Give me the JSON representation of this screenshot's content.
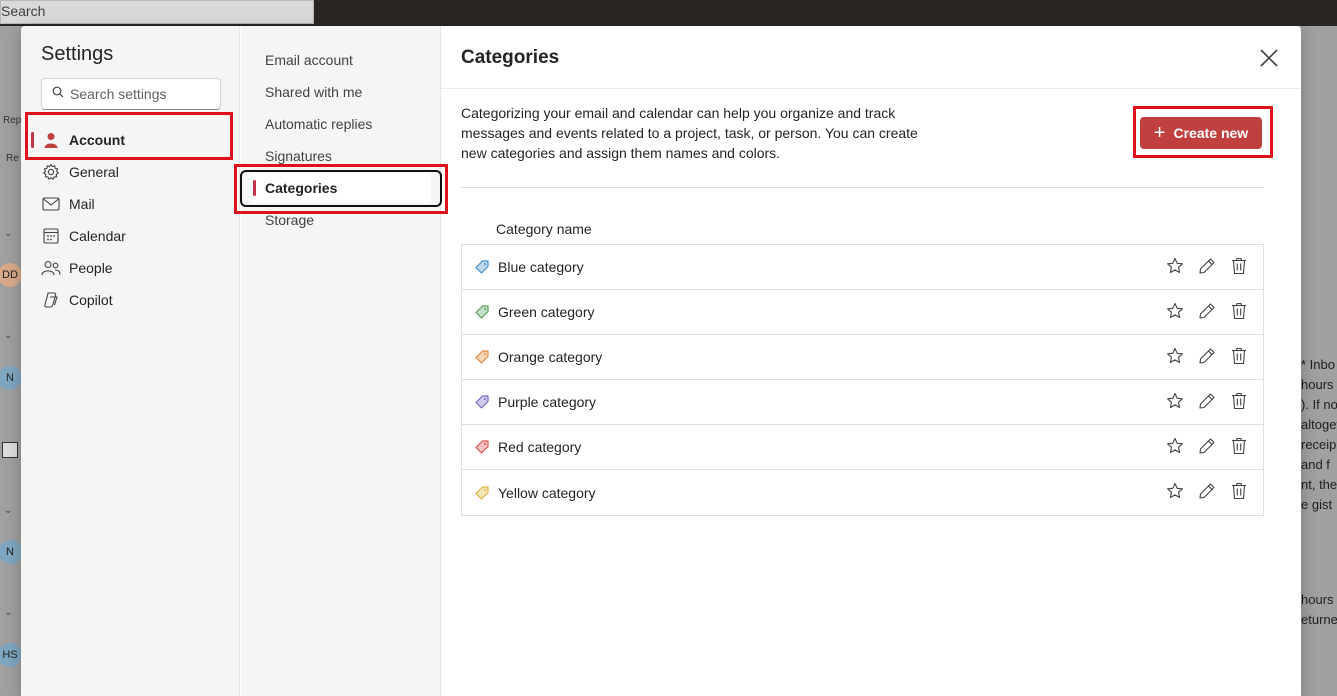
{
  "background": {
    "search_label": "Search",
    "avatars": [
      "DD",
      "N",
      "N",
      "HS"
    ],
    "tiny_labels": [
      "Rep",
      "Re"
    ],
    "right_text_lines": [
      "* Inbo",
      "hours",
      "). If no",
      "altoget",
      "receip",
      "and f",
      "nt, the",
      "e gist"
    ],
    "right_text_lines2": [
      "hours",
      "eturne"
    ]
  },
  "settings": {
    "title": "Settings",
    "search_placeholder": "Search settings",
    "nav": [
      {
        "label": "Account",
        "icon": "person-icon",
        "selected": true
      },
      {
        "label": "General",
        "icon": "gear-icon"
      },
      {
        "label": "Mail",
        "icon": "mail-icon"
      },
      {
        "label": "Calendar",
        "icon": "calendar-icon"
      },
      {
        "label": "People",
        "icon": "people-icon"
      },
      {
        "label": "Copilot",
        "icon": "copilot-icon"
      }
    ],
    "subnav": [
      {
        "label": "Email account"
      },
      {
        "label": "Shared with me"
      },
      {
        "label": "Automatic replies"
      },
      {
        "label": "Signatures"
      },
      {
        "label": "Categories",
        "selected": true
      },
      {
        "label": "Storage"
      }
    ]
  },
  "main": {
    "title": "Categories",
    "description": "Categorizing your email and calendar can help you organize and track messages and events related to a project, task, or person. You can create new categories and assign them names and colors.",
    "create_label": "Create new",
    "column_header": "Category name",
    "categories": [
      {
        "name": "Blue category",
        "color": "#4a90c8"
      },
      {
        "name": "Green category",
        "color": "#5aa05a"
      },
      {
        "name": "Orange category",
        "color": "#e08a3c"
      },
      {
        "name": "Purple category",
        "color": "#7b68c8"
      },
      {
        "name": "Red category",
        "color": "#d9534f"
      },
      {
        "name": "Yellow category",
        "color": "#e0b43a"
      }
    ]
  },
  "colors": {
    "accent": "#c04040",
    "highlight": "#e0101d"
  }
}
